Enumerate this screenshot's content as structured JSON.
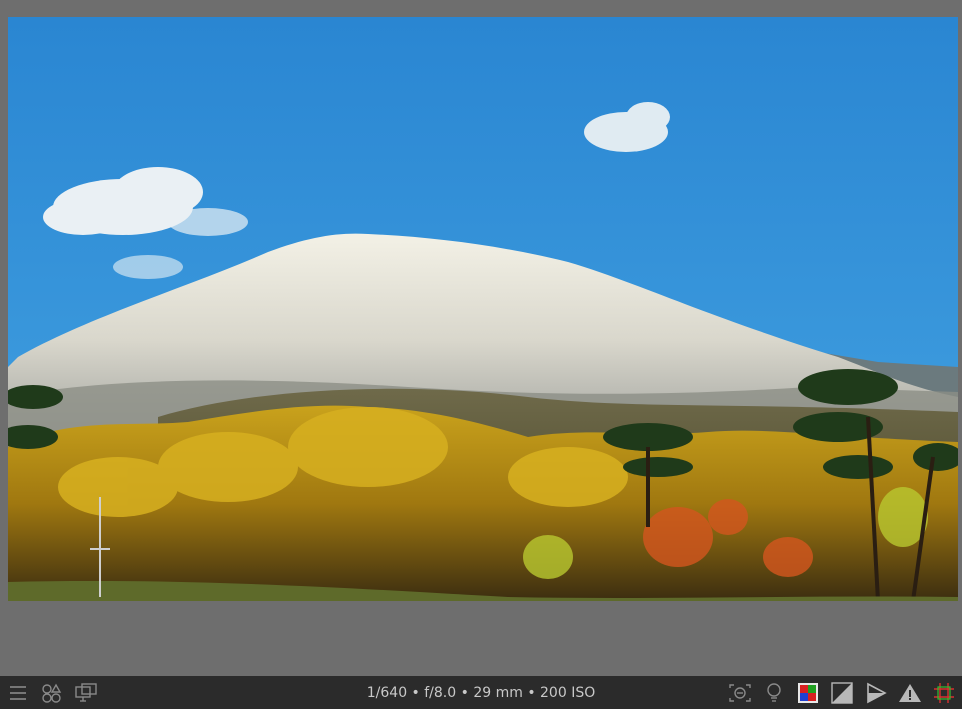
{
  "statusbar": {
    "exif_info": "1/640 • f/8.0 • 29 mm • 200 ISO"
  },
  "toolbar_left": [
    {
      "name": "menu-icon"
    },
    {
      "name": "styles-icon"
    },
    {
      "name": "display-icon"
    }
  ],
  "toolbar_right": [
    {
      "name": "focus-peaking-icon"
    },
    {
      "name": "iso-warning-icon"
    },
    {
      "name": "color-assessment-icon"
    },
    {
      "name": "softproof-icon"
    },
    {
      "name": "gamut-check-icon"
    },
    {
      "name": "overexposed-warning-icon"
    },
    {
      "name": "guides-icon"
    }
  ],
  "colors": {
    "background": "#6e6e6e",
    "statusbar": "#2b2b2b",
    "text": "#c8c8c8",
    "sky": "#2f8ad0"
  }
}
